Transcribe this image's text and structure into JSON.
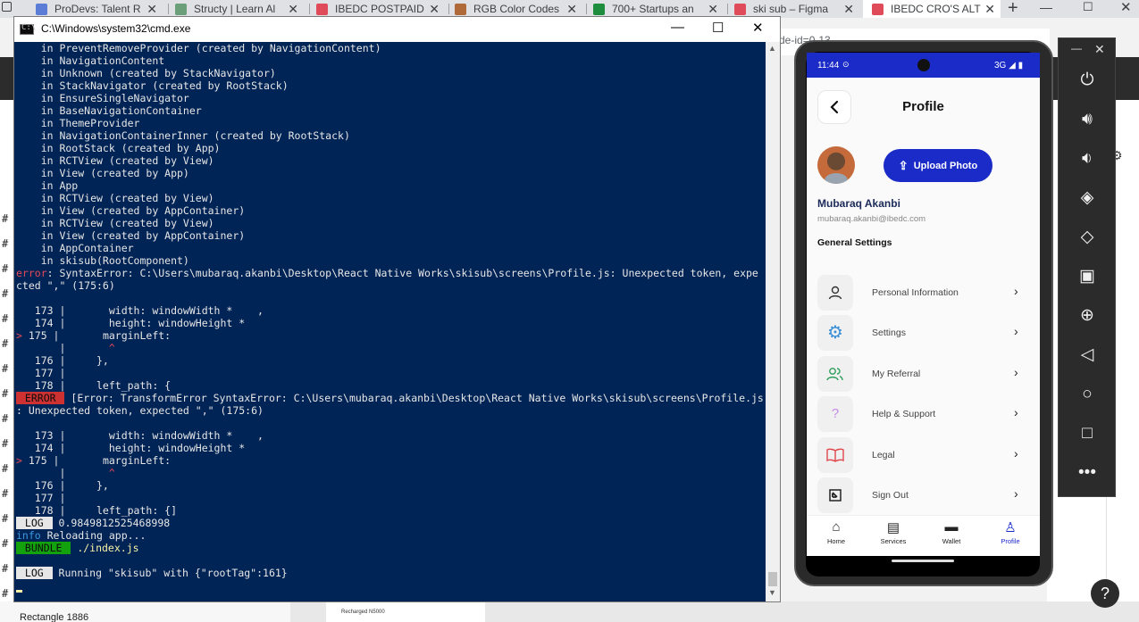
{
  "browser": {
    "tabs": [
      {
        "label": "ProDevs: Talent R",
        "fav_color": "#5b7dd6"
      },
      {
        "label": "Structy | Learn Al",
        "fav_color": "#6a9f7a"
      },
      {
        "label": "IBEDC POSTPAID",
        "fav_color": "#e04b5a"
      },
      {
        "label": "RGB Color Codes",
        "fav_color": "#b06a3a"
      },
      {
        "label": "700+ Startups an",
        "fav_color": "#1e8e3e"
      },
      {
        "label": "ski sub – Figma",
        "fav_color": "#e04b5a"
      },
      {
        "label": "IBEDC CRO'S ALT",
        "fav_color": "#e04b5a"
      }
    ],
    "new_tab": "+",
    "url_fragment": "de-id=0-13"
  },
  "background": {
    "rectangle_label": "Rectangle 1886",
    "recharged_label": "Recharged N5000",
    "right_text1": "r",
    "right_text2": "e"
  },
  "cmd": {
    "title": "C:\\Windows\\system32\\cmd.exe",
    "lines": {
      "l1": "    in PreventRemoveProvider (created by NavigationContent)",
      "l2": "    in NavigationContent",
      "l3": "    in Unknown (created by StackNavigator)",
      "l4": "    in StackNavigator (created by RootStack)",
      "l5": "    in EnsureSingleNavigator",
      "l6": "    in BaseNavigationContainer",
      "l7": "    in ThemeProvider",
      "l8": "    in NavigationContainerInner (created by RootStack)",
      "l9": "    in RootStack (created by App)",
      "l10": "    in RCTView (created by View)",
      "l11": "    in View (created by App)",
      "l12": "    in App",
      "l13": "    in RCTView (created by View)",
      "l14": "    in View (created by AppContainer)",
      "l15": "    in RCTView (created by View)",
      "l16": "    in View (created by AppContainer)",
      "l17": "    in AppContainer",
      "l18": "    in skisub(RootComponent)",
      "err1_prefix": "error",
      "err1_text": ": SyntaxError: C:\\Users\\mubaraq.akanbi\\Desktop\\React Native Works\\skisub\\screens\\Profile.js: Unexpected token, expe",
      "err1_cont": "cted \",\" (175:6)",
      "c1_173": "   173 |       width: windowWidth *    ,",
      "c1_174": "   174 |       height: windowHeight *",
      "c1_175_mark": ">",
      "c1_175": " 175 |       marginLeft:",
      "c1_caret_bar": "       |       ",
      "c1_caret": "^",
      "c1_176": "   176 |     },",
      "c1_177": "   177 |",
      "c1_178": "   178 |     left_path: {",
      "err2_badge": " ERROR ",
      "err2_text": " [Error: TransformError SyntaxError: C:\\Users\\mubaraq.akanbi\\Desktop\\React Native Works\\skisub\\screens\\Profile.js",
      "err2_cont": ": Unexpected token, expected \",\" (175:6)",
      "c2_173": "   173 |       width: windowWidth *    ,",
      "c2_174": "   174 |       height: windowHeight *",
      "c2_175_mark": ">",
      "c2_175": " 175 |       marginLeft:",
      "c2_caret_bar": "       |       ",
      "c2_caret": "^",
      "c2_176": "   176 |     },",
      "c2_177": "   177 |",
      "c2_178": "   178 |     left_path: {]",
      "log1_badge": " LOG ",
      "log1_text": " 0.9849812525468998",
      "info_prefix": "info",
      "info_text": " Reloading app...",
      "bundle_badge": " BUNDLE ",
      "bundle_text": " ./index.js",
      "log2_badge": " LOG ",
      "log2_text": " Running \"skisub\" with {\"rootTag\":161}"
    }
  },
  "phone": {
    "status": {
      "time": "11:44",
      "right": "3G"
    },
    "title": "Profile",
    "upload_label": "Upload Photo",
    "user_name": "Mubaraq Akanbi",
    "user_email": "mubaraq.akanbi@ibedc.com",
    "section_title": "General Settings",
    "menu": [
      {
        "label": "Personal Information",
        "icon": "person-icon",
        "color": "#333333"
      },
      {
        "label": "Settings",
        "icon": "gear-icon",
        "color": "#3a8fd6"
      },
      {
        "label": "My Referral",
        "icon": "people-icon",
        "color": "#2e9e5b"
      },
      {
        "label": "Help & Support",
        "icon": "question-icon",
        "color": "#a55bd6"
      },
      {
        "label": "Legal",
        "icon": "book-icon",
        "color": "#e0484d"
      },
      {
        "label": "Sign Out",
        "icon": "signout-icon",
        "color": "#222222"
      }
    ],
    "nav": [
      {
        "label": "Home"
      },
      {
        "label": "Services"
      },
      {
        "label": "Wallet"
      },
      {
        "label": "Profile"
      }
    ],
    "accent": "#1a2bc8"
  }
}
